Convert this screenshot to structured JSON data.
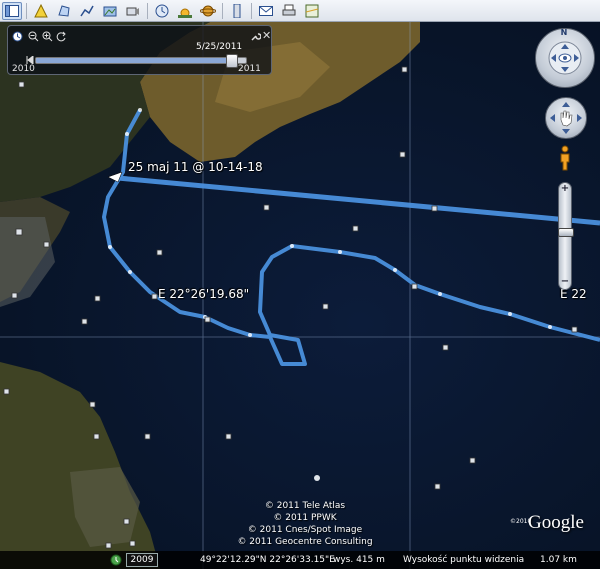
{
  "toolbar": {
    "buttons": [
      {
        "name": "sidebar-toggle-icon",
        "active": true
      },
      {
        "name": "add-placemark-icon"
      },
      {
        "name": "add-polygon-icon"
      },
      {
        "name": "add-path-icon"
      },
      {
        "name": "add-image-overlay-icon"
      },
      {
        "name": "record-tour-icon"
      },
      {
        "name": "historical-imagery-icon"
      },
      {
        "name": "sunlight-icon"
      },
      {
        "name": "switch-to-sky-icon"
      },
      {
        "name": "ruler-icon"
      },
      {
        "name": "email-icon"
      },
      {
        "name": "print-icon"
      },
      {
        "name": "view-in-maps-icon"
      }
    ]
  },
  "time_slider": {
    "current_date": "5/25/2011",
    "start_year": "2010",
    "end_year": "2011",
    "position": 0.95
  },
  "map_labels": {
    "timestamp": "25 maj 11 @ 10-14-18",
    "longitude_marker": "E 22°26'19.68\"",
    "edge_label": "E 22"
  },
  "copyright": {
    "lines": [
      "© 2011 Tele Atlas",
      "© 2011 PPWK",
      "© 2011 Cnes/Spot Image",
      "© 2011 Geocentre Consulting"
    ]
  },
  "brand": {
    "year": "©2010",
    "name": "Google"
  },
  "status_bar": {
    "imagery_year": "2009",
    "coordinates": "49°22'12.29\"N  22°26'33.15\"E",
    "elevation": "wys. 415 m",
    "eye_altitude_label": "Wysokość punktu widzenia",
    "eye_altitude_value": "1.07 km"
  },
  "navigation": {
    "north_label": "N",
    "zoom_in_label": "+",
    "zoom_out_label": "−",
    "zoom_level": 0.5
  },
  "colors": {
    "track": "#4a90dd",
    "water": "#0a1830",
    "land": "#6b5a2c"
  }
}
